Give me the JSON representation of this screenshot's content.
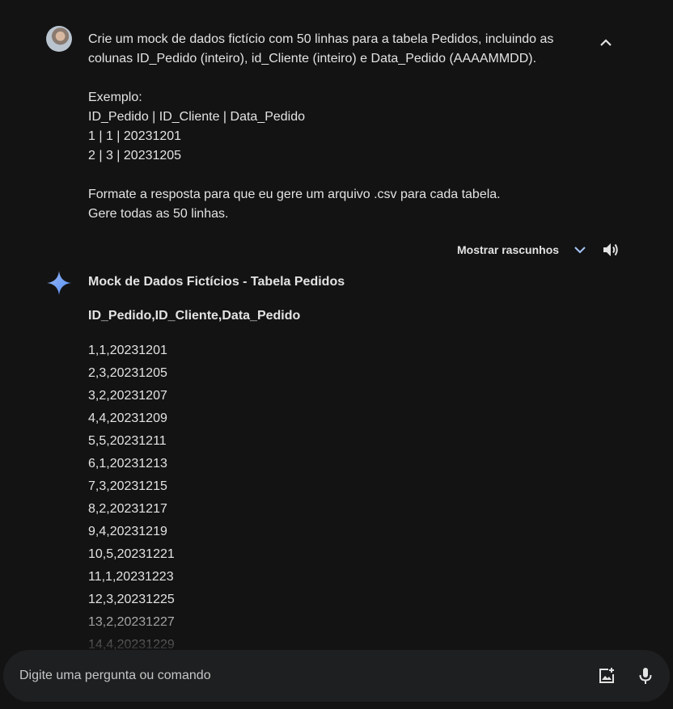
{
  "user_message": {
    "lines": [
      "Crie um mock de dados fictício com 50 linhas para a tabela Pedidos, incluindo as",
      "colunas ID_Pedido (inteiro), id_Cliente (inteiro) e Data_Pedido (AAAAMMDD).",
      "",
      "Exemplo:",
      "ID_Pedido | ID_Cliente | Data_Pedido",
      "1 | 1 | 20231201",
      "2 | 3 | 20231205",
      "",
      "Formate a resposta para que eu gere um arquivo .csv para cada tabela.",
      "Gere todas as 50 linhas."
    ]
  },
  "actions": {
    "drafts_label": "Mostrar rascunhos"
  },
  "response": {
    "title": "Mock de Dados Fictícios - Tabela Pedidos",
    "csv_header": "ID_Pedido,ID_Cliente,Data_Pedido",
    "rows": [
      "1,1,20231201",
      "2,3,20231205",
      "3,2,20231207",
      "4,4,20231209",
      "5,5,20231211",
      "6,1,20231213",
      "7,3,20231215",
      "8,2,20231217",
      "9,4,20231219",
      "10,5,20231221",
      "11,1,20231223",
      "12,3,20231225",
      "13,2,20231227",
      "14,4,20231229"
    ]
  },
  "input": {
    "placeholder": "Digite uma pergunta ou comando",
    "value": ""
  },
  "icons": {
    "collapse": "chevron-up-icon",
    "drafts_toggle": "chevron-down-icon",
    "speaker": "volume-icon",
    "assistant": "sparkle-icon",
    "image_upload": "add-image-icon",
    "mic": "microphone-icon"
  },
  "colors": {
    "background": "#131314",
    "input_bar": "#1e1f20",
    "text": "#e3e3e3",
    "accent_blue": "#4f8df5"
  }
}
